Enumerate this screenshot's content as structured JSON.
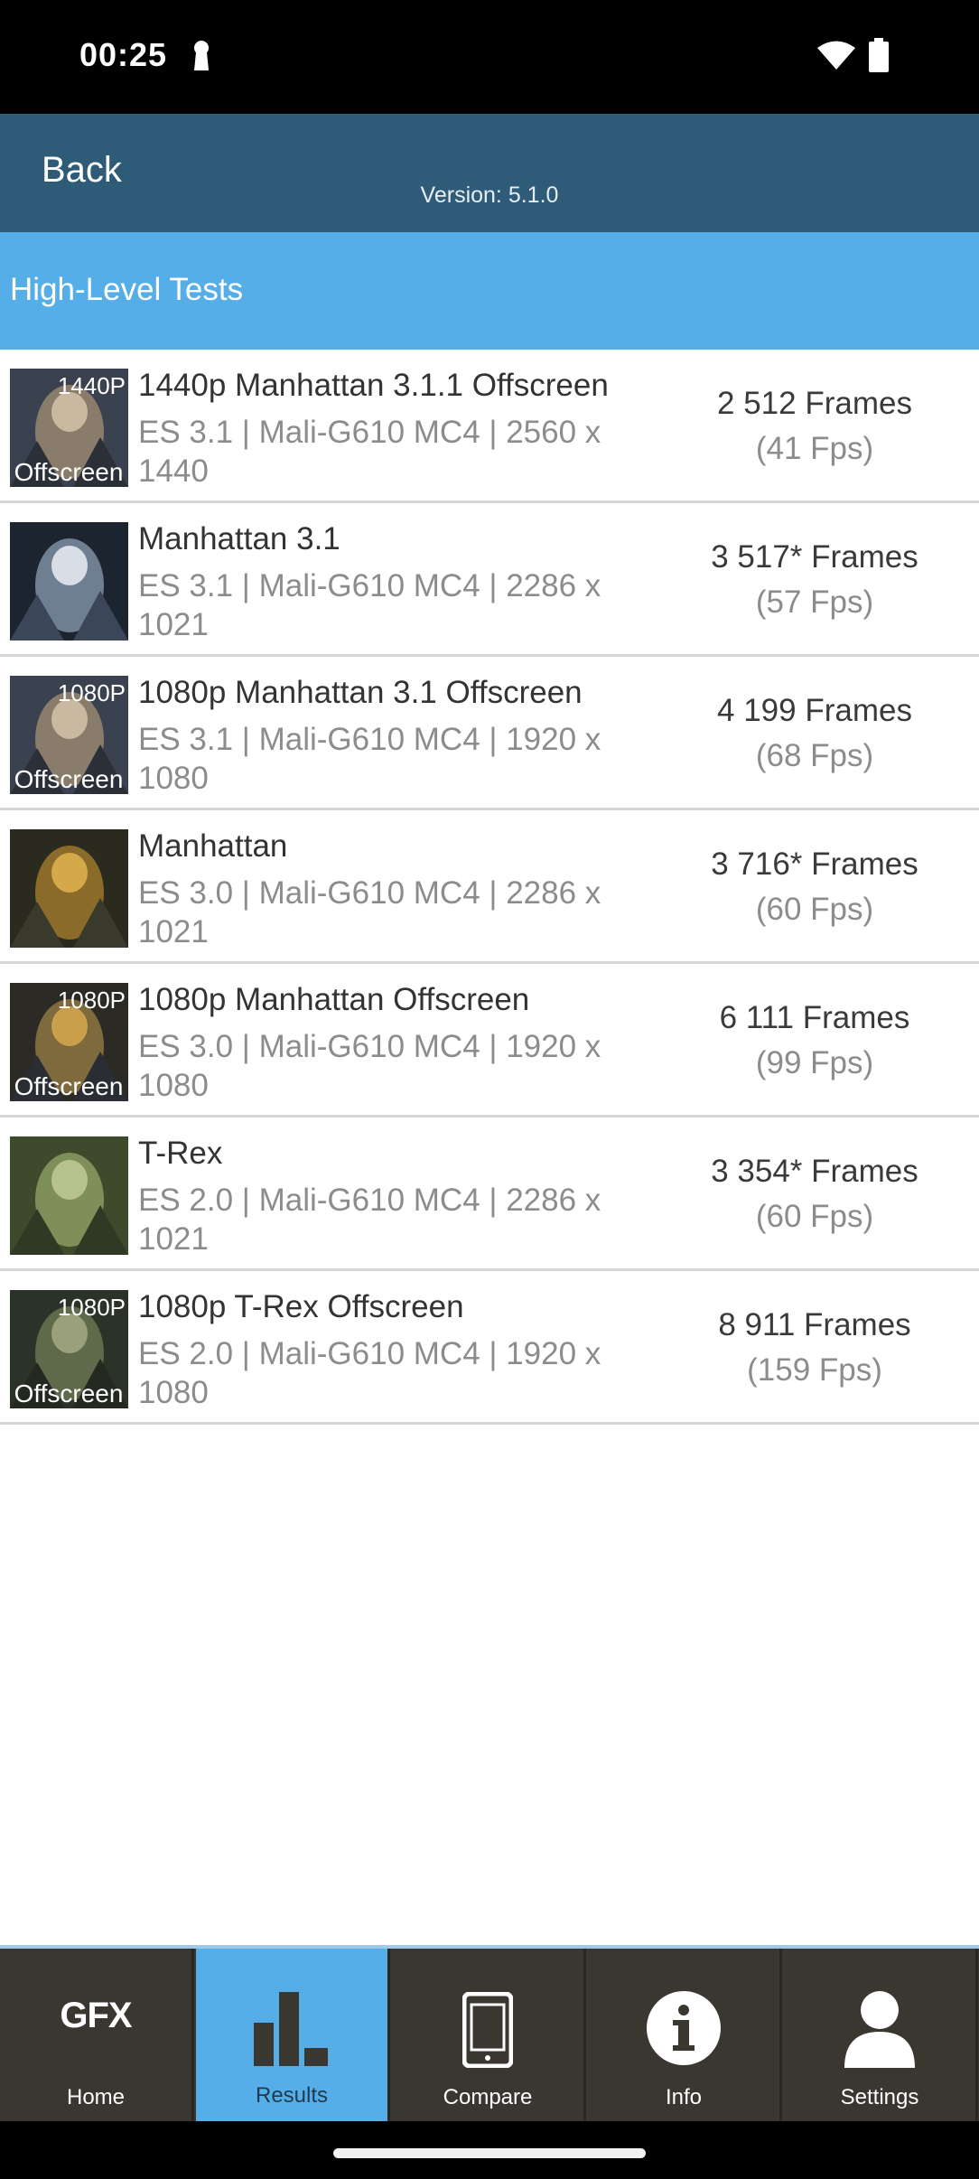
{
  "status_bar": {
    "time": "00:25"
  },
  "header": {
    "back_label": "Back",
    "version": "Version: 5.1.0"
  },
  "section": {
    "title": "High-Level Tests"
  },
  "tests": [
    {
      "name": "1440p Manhattan 3.1.1 Offscreen",
      "details": "ES 3.1 | Mali-G610 MC4 | 2560 x 1440",
      "frames": "2 512 Frames",
      "fps": "(41 Fps)",
      "thumb_top": "1440P",
      "thumb_bottom": "Offscreen"
    },
    {
      "name": "Manhattan 3.1",
      "details": "ES 3.1 | Mali-G610 MC4 | 2286 x 1021",
      "frames": "3 517* Frames",
      "fps": "(57 Fps)"
    },
    {
      "name": "1080p Manhattan 3.1 Offscreen",
      "details": "ES 3.1 | Mali-G610 MC4 | 1920 x 1080",
      "frames": "4 199 Frames",
      "fps": "(68 Fps)",
      "thumb_top": "1080P",
      "thumb_bottom": "Offscreen"
    },
    {
      "name": "Manhattan",
      "details": "ES 3.0 | Mali-G610 MC4 | 2286 x 1021",
      "frames": "3 716* Frames",
      "fps": "(60 Fps)"
    },
    {
      "name": "1080p Manhattan Offscreen",
      "details": "ES 3.0 | Mali-G610 MC4 | 1920 x 1080",
      "frames": "6 111 Frames",
      "fps": "(99 Fps)",
      "thumb_top": "1080P",
      "thumb_bottom": "Offscreen"
    },
    {
      "name": "T-Rex",
      "details": "ES 2.0 | Mali-G610 MC4 | 2286 x 1021",
      "frames": "3 354* Frames",
      "fps": "(60 Fps)"
    },
    {
      "name": "1080p T-Rex Offscreen",
      "details": "ES 2.0 | Mali-G610 MC4 | 1920 x 1080",
      "frames": "8 911 Frames",
      "fps": "(159 Fps)",
      "thumb_top": "1080P",
      "thumb_bottom": "Offscreen"
    }
  ],
  "tabs": [
    {
      "label": "Home",
      "logo": "GFX",
      "icon": "gfx-logo-icon"
    },
    {
      "label": "Results",
      "icon": "bar-chart-icon",
      "active": true
    },
    {
      "label": "Compare",
      "icon": "phone-icon"
    },
    {
      "label": "Info",
      "icon": "info-icon"
    },
    {
      "label": "Settings",
      "icon": "user-icon"
    }
  ],
  "colors": {
    "header": "#2e5b78",
    "section": "#56aee8",
    "tab_active": "#56aee8",
    "tab_bg": "#3a3630"
  }
}
